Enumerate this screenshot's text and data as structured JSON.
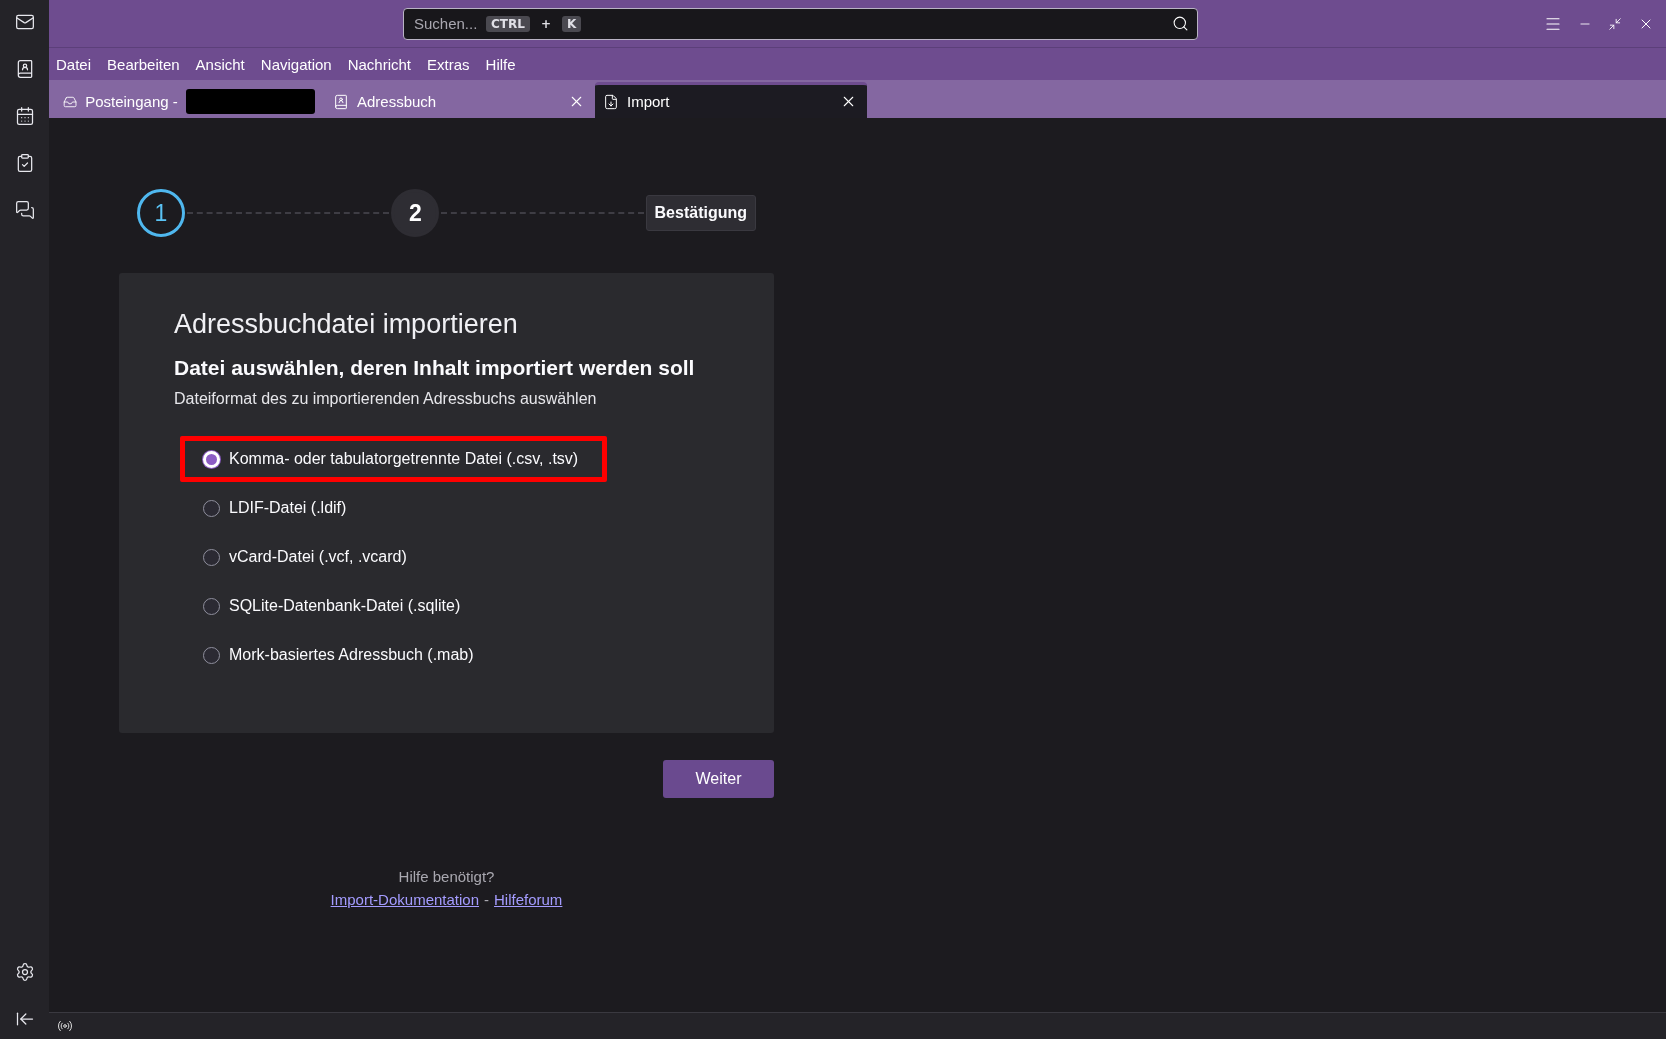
{
  "search": {
    "placeholder": "Suchen...",
    "shortcut": [
      "CTRL",
      "+",
      "K"
    ]
  },
  "menu": [
    "Datei",
    "Bearbeiten",
    "Ansicht",
    "Navigation",
    "Nachricht",
    "Extras",
    "Hilfe"
  ],
  "tabs": [
    {
      "label": "Posteingang -",
      "kind": "inbox",
      "redacted": true,
      "closable": false,
      "selected": false
    },
    {
      "label": "Adressbuch",
      "kind": "addressbook",
      "redacted": false,
      "closable": true,
      "selected": false
    },
    {
      "label": "Import",
      "kind": "import",
      "redacted": false,
      "closable": true,
      "selected": true
    }
  ],
  "stepper": [
    {
      "label": "1",
      "kind": "circle",
      "selected": true
    },
    {
      "label": "2",
      "kind": "circle",
      "selected": false
    },
    {
      "label": "Bestätigung",
      "kind": "box",
      "selected": false
    }
  ],
  "card": {
    "title": "Adressbuchdatei importieren",
    "subtitle": "Datei auswählen, deren Inhalt importiert werden soll",
    "description": "Dateiformat des zu importierenden Adressbuchs auswählen",
    "options": [
      {
        "label": "Komma- oder tabulatorgetrennte Datei (.csv, .tsv)",
        "selected": true,
        "highlighted": true
      },
      {
        "label": "LDIF-Datei (.ldif)",
        "selected": false,
        "highlighted": false
      },
      {
        "label": "vCard-Datei (.vcf, .vcard)",
        "selected": false,
        "highlighted": false
      },
      {
        "label": "SQLite-Datenbank-Datei (.sqlite)",
        "selected": false,
        "highlighted": false
      },
      {
        "label": "Mork-basiertes Adressbuch (.mab)",
        "selected": false,
        "highlighted": false
      }
    ]
  },
  "next_button": "Weiter",
  "help": {
    "question": "Hilfe benötigt?",
    "links": [
      "Import-Dokumentation",
      "Hilfeforum"
    ],
    "separator": "-"
  }
}
